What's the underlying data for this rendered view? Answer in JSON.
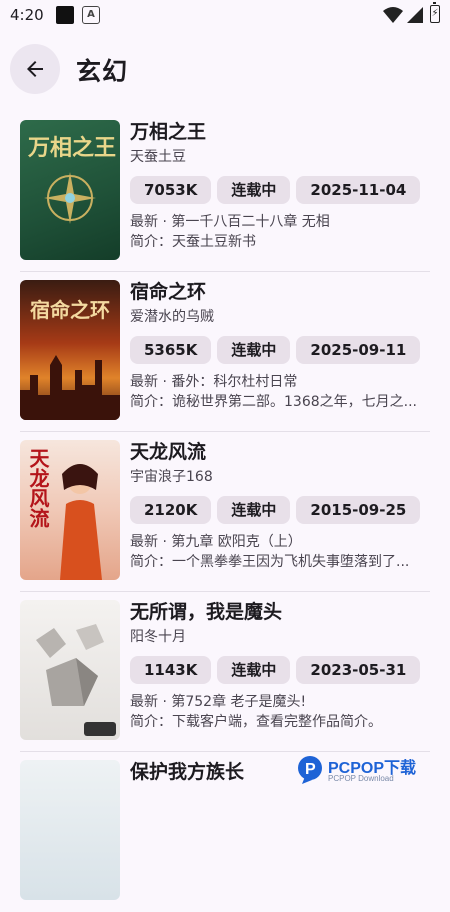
{
  "status_bar": {
    "time": "4:20"
  },
  "app_bar": {
    "title": "玄幻"
  },
  "books": [
    {
      "title": "万相之王",
      "author": "天蚕土豆",
      "words": "7053K",
      "status": "连载中",
      "date": "2025-11-04",
      "latest": "最新 · 第一千八百二十八章 无相",
      "intro": "简介：天蚕土豆新书",
      "cover_title": "万相之王"
    },
    {
      "title": "宿命之环",
      "author": "爱潜水的乌贼",
      "words": "5365K",
      "status": "连载中",
      "date": "2025-09-11",
      "latest": "最新 · 番外：科尔杜村日常",
      "intro": "简介：诡秘世界第二部。1368之年，七月之...",
      "cover_title": "宿命之环"
    },
    {
      "title": "天龙风流",
      "author": "宇宙浪子168",
      "words": "2120K",
      "status": "连载中",
      "date": "2015-09-25",
      "latest": "最新 · 第九章 欧阳克（上）",
      "intro": "简介：一个黑拳拳王因为飞机失事堕落到了...",
      "cover_title": "天龙风流"
    },
    {
      "title": "无所谓，我是魔头",
      "author": "阳冬十月",
      "words": "1143K",
      "status": "连载中",
      "date": "2023-05-31",
      "latest": "最新 · 第752章 老子是魔头!",
      "intro": "简介：下载客户端，查看完整作品简介。",
      "cover_title": ""
    },
    {
      "title": "保护我方族长",
      "author": "",
      "words": "",
      "status": "",
      "date": "",
      "latest": "",
      "intro": "",
      "cover_title": ""
    }
  ],
  "watermark": {
    "text": "PCPOP下载",
    "sub": "PCPOP Download"
  },
  "colors": {
    "background": "#fbf7fd",
    "chip": "#e8e0e9",
    "back_button": "#ece6f0",
    "watermark_blue": "#1e63d6"
  },
  "icons": {
    "back": "arrow-left-icon",
    "wifi": "wifi-icon",
    "signal": "signal-icon",
    "battery": "battery-icon"
  }
}
